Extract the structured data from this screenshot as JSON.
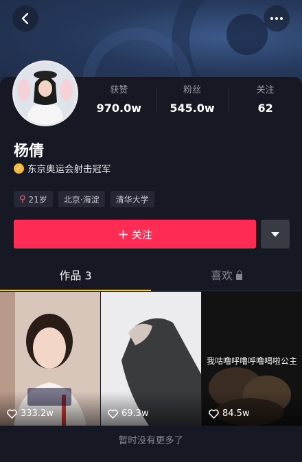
{
  "profile": {
    "name": "杨倩",
    "verify_text": "东京奥运会射击冠军",
    "stats": [
      {
        "label": "获赞",
        "value": "970.0w"
      },
      {
        "label": "粉丝",
        "value": "545.0w"
      },
      {
        "label": "关注",
        "value": "62"
      }
    ],
    "tags": [
      "21岁",
      "北京·海淀",
      "清华大学"
    ],
    "gender": "female"
  },
  "actions": {
    "follow_label": "+ 关注",
    "follow_plus": "+",
    "follow_text": "关注"
  },
  "tabs": [
    {
      "label": "作品 3",
      "active": true
    },
    {
      "label": "喜欢",
      "active": false,
      "locked": true
    }
  ],
  "videos": [
    {
      "likes": "333.2w",
      "caption": "",
      "overlay": ""
    },
    {
      "likes": "69.3w",
      "caption": "",
      "overlay": ""
    },
    {
      "likes": "84.5w",
      "caption": "我咕噜呼噜呼噜喝啦公主",
      "overlay": ""
    }
  ],
  "footer_text": "暂时没有更多了",
  "colors": {
    "accent": "#fe2c55",
    "tab_indicator": "#face15",
    "background": "#161823",
    "verified_badge": "#f5b83c"
  },
  "icons": {
    "back": "back-icon",
    "more": "more-icon",
    "dropdown": "chevron-down-icon",
    "like": "heart-icon",
    "lock": "lock-icon",
    "gender": "female-icon",
    "verified": "verified-icon"
  }
}
